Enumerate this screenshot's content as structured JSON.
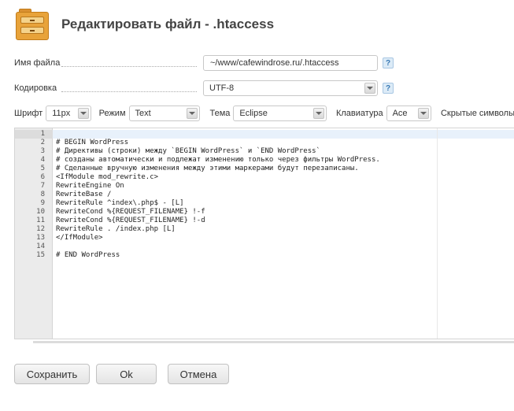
{
  "header": {
    "icon": "file-cabinet-icon",
    "title": "Редактировать файл - .htaccess"
  },
  "form": {
    "filename": {
      "label": "Имя файла",
      "value": "~/www/cafewindrose.ru/.htaccess",
      "help": "?"
    },
    "encoding": {
      "label": "Кодировка",
      "value": "UTF-8",
      "help": "?"
    }
  },
  "toolbar": {
    "font": {
      "label": "Шрифт",
      "value": "11px"
    },
    "mode": {
      "label": "Режим",
      "value": "Text"
    },
    "theme": {
      "label": "Тема",
      "value": "Eclipse"
    },
    "keyboard": {
      "label": "Клавиатура",
      "value": "Ace"
    },
    "hidden_chars": {
      "label": "Скрытые символы"
    }
  },
  "editor": {
    "line_numbers": "1\n2\n3\n4\n5\n6\n7\n8\n9\n10\n11\n12\n13\n14\n15",
    "code": "\n# BEGIN WordPress\n# Директивы (строки) между `BEGIN WordPress` и `END WordPress`\n# созданы автоматически и подлежат изменению только через фильтры WordPress.\n# Сделанные вручную изменения между этими маркерами будут перезаписаны.\n<IfModule mod_rewrite.c>\nRewriteEngine On\nRewriteBase /\nRewriteRule ^index\\.php$ - [L]\nRewriteCond %{REQUEST_FILENAME} !-f\nRewriteCond %{REQUEST_FILENAME} !-d\nRewriteRule . /index.php [L]\n</IfModule>\n\n# END WordPress"
  },
  "buttons": {
    "save": "Сохранить",
    "ok": "Ok",
    "cancel": "Отмена"
  }
}
